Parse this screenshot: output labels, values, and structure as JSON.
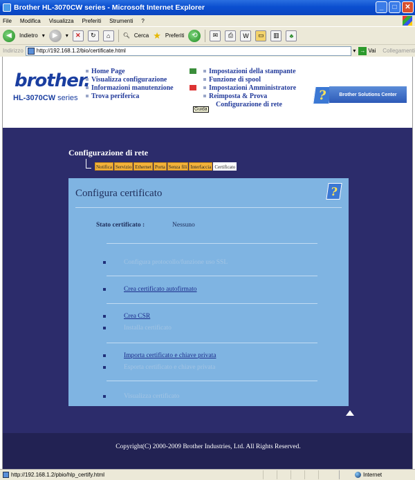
{
  "window": {
    "title": "Brother HL-3070CW series - Microsoft Internet Explorer"
  },
  "menu": [
    "File",
    "Modifica",
    "Visualizza",
    "Preferiti",
    "Strumenti",
    "?"
  ],
  "toolbar": {
    "back": "Indietro",
    "search": "Cerca",
    "favorites": "Preferiti"
  },
  "address": {
    "label": "Indirizzo",
    "url": "http://192.168.1.2/bio/certificate.html",
    "go": "Vai",
    "links": "Collegamenti"
  },
  "brand": {
    "logo": "brother.",
    "model_prefix": "HL-3070CW",
    "model_suffix": " series"
  },
  "nav": {
    "left": [
      "Home Page",
      "Visualizza configurazione",
      "Informazioni manutenzione",
      "Trova periferica"
    ],
    "right": [
      "Impostazioni della stampante",
      "Funzione di spool",
      "Impostazioni Amministratore",
      "Reimposta & Prova",
      "Configurazione di rete"
    ],
    "tooltip": "Guida",
    "solutions": "Brother Solutions Center"
  },
  "section": {
    "title": "Configurazione di rete",
    "tabs": [
      "Notifica",
      "Servizio",
      "Ethernet",
      "Porta",
      "Senza fili",
      "Interfaccia",
      "Certificato"
    ],
    "active_tab": "Certificato"
  },
  "panel": {
    "title": "Configura certificato",
    "status_label": "Stato certificato :",
    "status_value": "Nessuno",
    "items": [
      {
        "label": "Configura protocollo/funzione uso SSL",
        "enabled": false
      },
      {
        "label": "Crea certificato autofirmato",
        "enabled": true
      },
      {
        "label": "Crea CSR",
        "enabled": true
      },
      {
        "label": "Installa certificato",
        "enabled": false
      },
      {
        "label": "Importa certificato e chiave privata",
        "enabled": true
      },
      {
        "label": "Esporta certificato e chiave privata",
        "enabled": false
      },
      {
        "label": "Visualizza certificato",
        "enabled": false
      }
    ]
  },
  "footer": {
    "copyright": "Copyright(C) 2000-2009 Brother Industries, Ltd. All Rights Reserved."
  },
  "statusbar": {
    "url": "http://192.168.1.2/pbio/hlp_certify.html",
    "zone": "Internet"
  }
}
